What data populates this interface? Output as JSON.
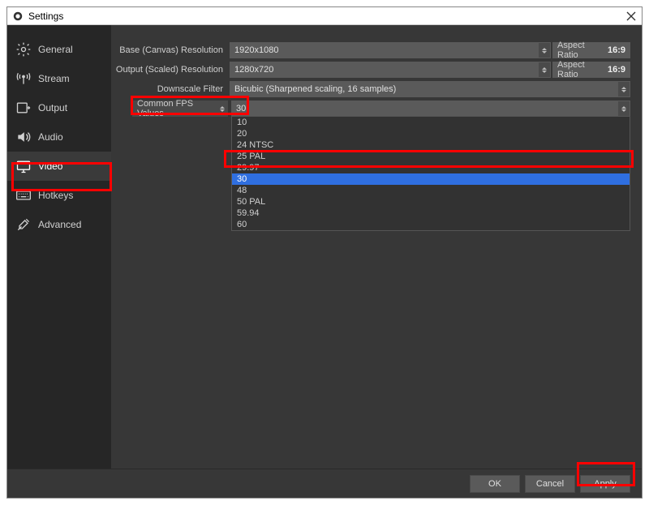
{
  "window": {
    "title": "Settings"
  },
  "sidebar": {
    "items": [
      {
        "label": "General"
      },
      {
        "label": "Stream"
      },
      {
        "label": "Output"
      },
      {
        "label": "Audio"
      },
      {
        "label": "Video"
      },
      {
        "label": "Hotkeys"
      },
      {
        "label": "Advanced"
      }
    ]
  },
  "video": {
    "base_label": "Base (Canvas) Resolution",
    "base_value": "1920x1080",
    "output_label": "Output (Scaled) Resolution",
    "output_value": "1280x720",
    "aspect_label": "Aspect Ratio",
    "aspect_value": "16:9",
    "downscale_label": "Downscale Filter",
    "downscale_value": "Bicubic (Sharpened scaling, 16 samples)",
    "fps_mode_label": "Common FPS Values",
    "fps_value": "30",
    "fps_options": [
      "10",
      "20",
      "24 NTSC",
      "25 PAL",
      "29.97",
      "30",
      "48",
      "50 PAL",
      "59.94",
      "60"
    ]
  },
  "footer": {
    "ok": "OK",
    "cancel": "Cancel",
    "apply": "Apply"
  }
}
